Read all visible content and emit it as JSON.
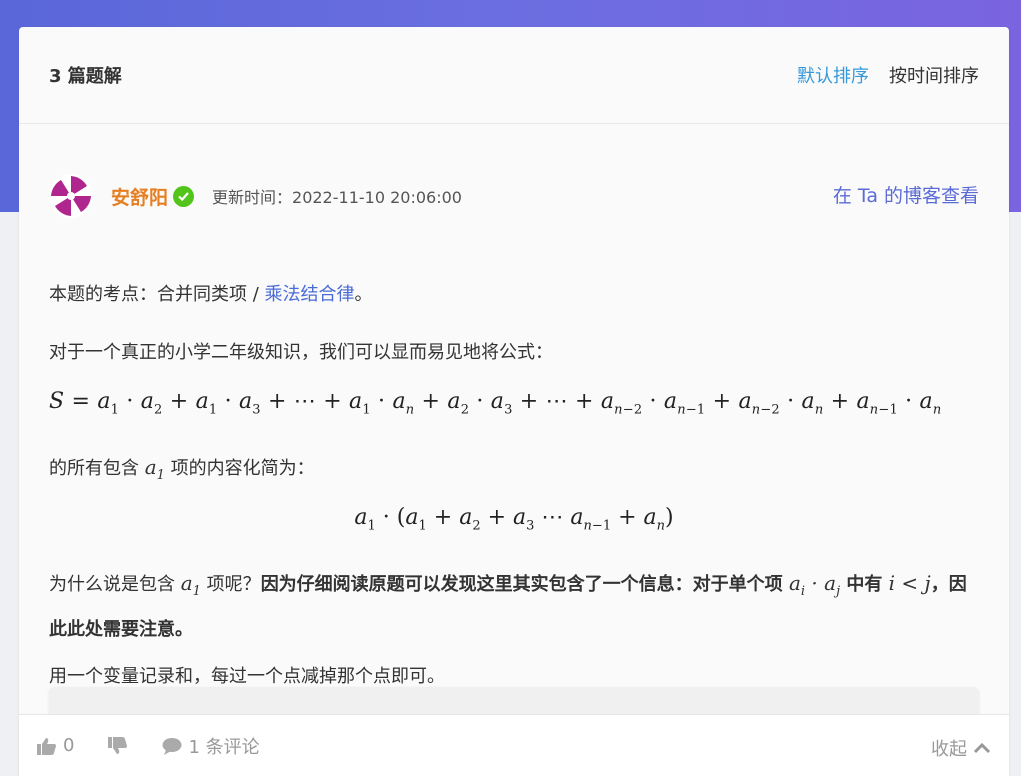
{
  "header": {
    "count_title": "3 篇题解",
    "sort_default": "默认排序",
    "sort_time": "按时间排序"
  },
  "post": {
    "author": "安舒阳",
    "updated": "更新时间：2022-11-10 20:06:00",
    "blog_link": "在 Ta 的博客查看",
    "p1_prefix": "本题的考点：合并同类项 / ",
    "p1_link": "乘法结合律",
    "p1_suffix": "。",
    "p2": "对于一个真正的小学二年级知识，我们可以显而易见地将公式：",
    "p3_prefix": "的所有包含 ",
    "p3_suffix": " 项的内容化简为：",
    "p4_prefix": "为什么说是包含 ",
    "p4_mid": " 项呢？",
    "p4_bold1": "因为仔细阅读原题可以发现这里其实包含了一个信息：对于单个项 ",
    "p4_bold2": " 中有 ",
    "p4_bold3": "，因此此处需要注意。",
    "p5": "用一个变量记录和，每过一个点减掉那个点即可。"
  },
  "footer": {
    "likes": "0",
    "comments": "1 条评论",
    "collapse": "收起"
  },
  "colors": {
    "accent_blue": "#3498db",
    "author_orange": "#e67e22",
    "verified_green": "#52c41a",
    "banner_gradient": "#5a67d8"
  }
}
